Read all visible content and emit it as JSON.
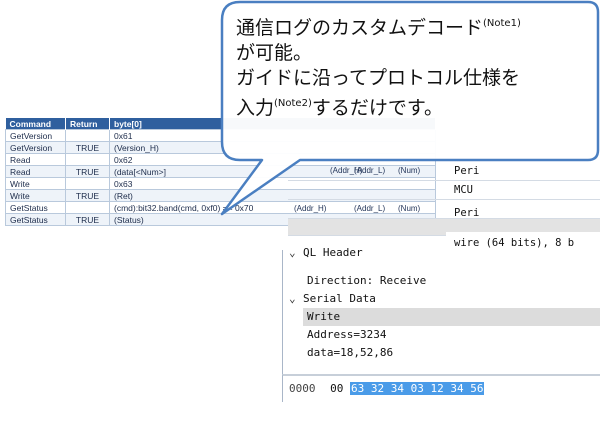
{
  "table": {
    "headers": [
      "Command",
      "Return",
      "byte[0]"
    ],
    "rows": [
      [
        "GetVersion",
        "",
        "0x61"
      ],
      [
        "GetVersion",
        "TRUE",
        "(Version_H)"
      ],
      [
        "Read",
        "",
        "0x62"
      ],
      [
        "Read",
        "TRUE",
        "(data[<Num>]"
      ],
      [
        "Write",
        "",
        "0x63"
      ],
      [
        "Write",
        "TRUE",
        "(Ret)"
      ],
      [
        "GetStatus",
        "",
        "(cmd):bit32.band(cmd, 0xf0) == 0x70"
      ],
      [
        "GetStatus",
        "TRUE",
        "(Status)"
      ]
    ]
  },
  "peri_grid": {
    "rows": [
      {
        "cells": [
          "(Addr_H)",
          "(Addr_L)",
          "(Num)"
        ],
        "box": "Peri"
      },
      {
        "cells": [
          "",
          "",
          ""
        ],
        "box": "MCU"
      },
      {
        "cells": [
          "(Addr_H)",
          "(Addr_L)",
          "(Num)"
        ],
        "box": "Peri"
      }
    ]
  },
  "wire_summary": "wire (64 bits), 8 b",
  "tree": {
    "ql_header": "QL Header",
    "direction": "Direction: Receive",
    "serial_data": "Serial Data",
    "write": "Write",
    "address": "Address=3234",
    "data": "data=18,52,86"
  },
  "hex": {
    "offset": "0000",
    "plain": "00",
    "highlighted": "63 32 34 03 12 34 56"
  },
  "bubble": {
    "line1": "通信ログのカスタムデコード",
    "note1": "(Note1)",
    "line2": "が可能。",
    "line3": "ガイドに沿ってプロトコル仕様を",
    "line4a": "入力",
    "note2": "(Note2)",
    "line4b": "するだけです。"
  },
  "colors": {
    "table_header": "#2f5f9e",
    "bubble_fill": "#ffffff",
    "bubble_border": "#4a7fc1",
    "hex_highlight": "#4a9be8"
  }
}
